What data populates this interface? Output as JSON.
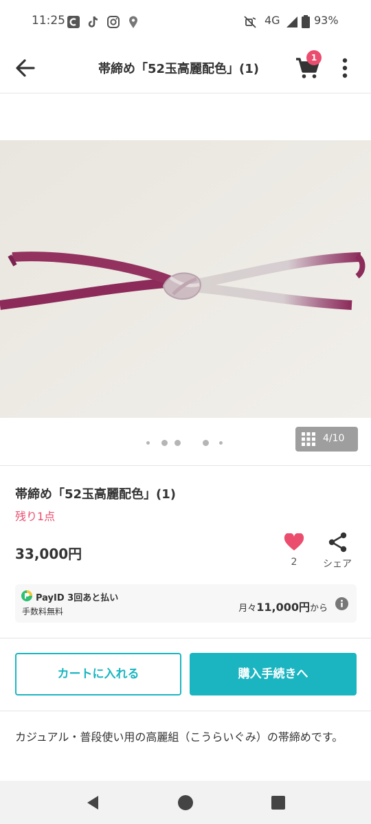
{
  "status_bar": {
    "time": "11:25",
    "network": "4G",
    "battery": "93%",
    "icons": [
      "c-app-icon",
      "tiktok-icon",
      "instagram-icon",
      "location-icon",
      "mute-icon",
      "signal-icon",
      "battery-icon"
    ]
  },
  "header": {
    "title": "帯締め「52玉高麗配色」(1)",
    "cart_badge": "1",
    "icons": {
      "back": "back-arrow-icon",
      "cart": "cart-icon",
      "menu": "more-vert-icon"
    }
  },
  "gallery": {
    "counter": "4/10",
    "dot_count": 5,
    "active_dot": 2
  },
  "product": {
    "title": "帯締め「52玉高麗配色」(1)",
    "stock": "残り1点",
    "price": "33,000円",
    "likes": "2",
    "share_label": "シェア"
  },
  "payid": {
    "brand": "PayID 3回あと払い",
    "sub": "手数料無料",
    "monthly_prefix": "月々",
    "monthly_amount": "11,000円",
    "monthly_suffix": "から"
  },
  "actions": {
    "add_to_cart": "カートに入れる",
    "checkout": "購入手続きへ"
  },
  "description": "カジュアル・普段使い用の高麗組（こうらいぐみ）の帯締めです。",
  "colors": {
    "accent": "#1ab5c1",
    "pink": "#ea4d6d",
    "cord_purple": "#8c2a5a"
  }
}
